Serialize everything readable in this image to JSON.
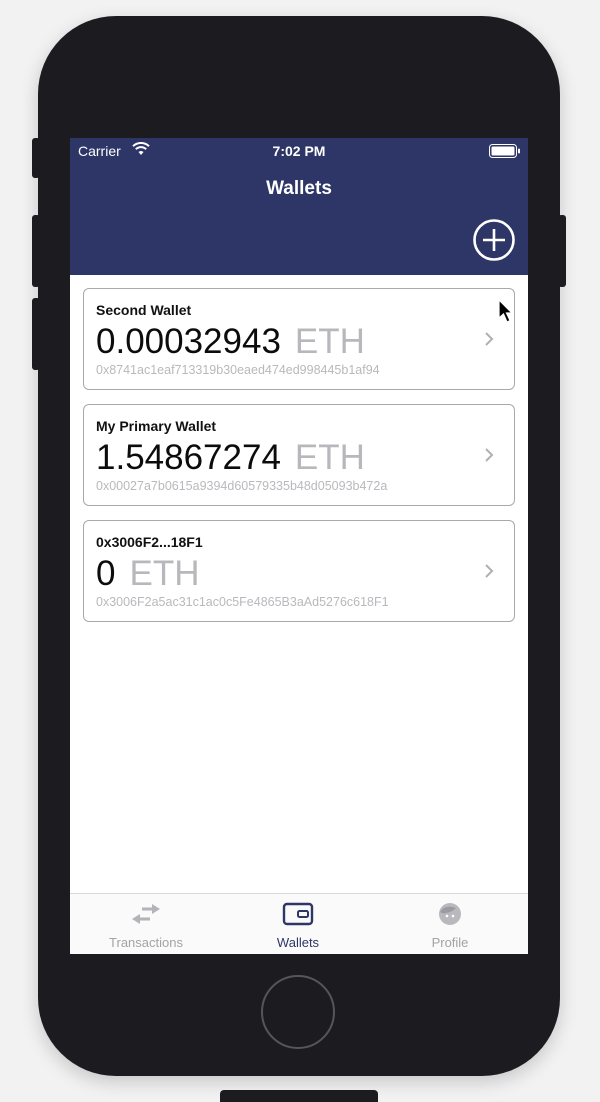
{
  "status_bar": {
    "carrier": "Carrier",
    "time": "7:02 PM"
  },
  "header": {
    "title": "Wallets"
  },
  "wallets": [
    {
      "name": "Second Wallet",
      "balance": "0.00032943",
      "unit": "ETH",
      "address": "0x8741ac1eaf713319b30eaed474ed998445b1af94"
    },
    {
      "name": "My Primary Wallet",
      "balance": "1.54867274",
      "unit": "ETH",
      "address": "0x00027a7b0615a9394d60579335b48d05093b472a"
    },
    {
      "name": "0x3006F2...18F1",
      "balance": "0",
      "unit": "ETH",
      "address": "0x3006F2a5ac31c1ac0c5Fe4865B3aAd5276c618F1"
    }
  ],
  "tabs": [
    {
      "label": "Transactions",
      "icon": "transactions-icon",
      "active": false
    },
    {
      "label": "Wallets",
      "icon": "wallet-icon",
      "active": true
    },
    {
      "label": "Profile",
      "icon": "profile-icon",
      "active": false
    }
  ],
  "colors": {
    "header_bg": "#2d3666",
    "accent": "#2d3666",
    "muted": "#b8b8bc"
  }
}
